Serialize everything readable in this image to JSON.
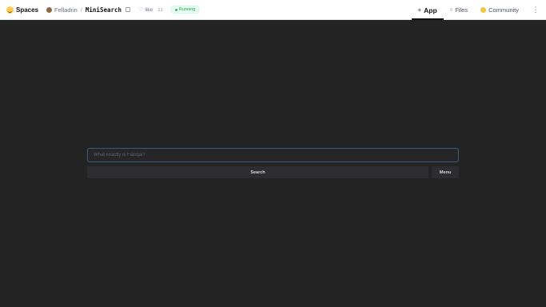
{
  "header": {
    "brand": "Spaces",
    "owner": "Felladrin",
    "repo": "MiniSearch",
    "like_label": "like",
    "like_count": "11",
    "status": "Running"
  },
  "nav": {
    "tabs": [
      {
        "label": "App",
        "active": true
      },
      {
        "label": "Files",
        "active": false
      },
      {
        "label": "Community",
        "active": false
      }
    ]
  },
  "app": {
    "search_placeholder": "What exactly is Fiasqai?",
    "search_label": "Search",
    "menu_label": "Menu"
  },
  "colors": {
    "background": "#232324",
    "status_green": "#16a34a",
    "input_border": "#3b5a78"
  }
}
